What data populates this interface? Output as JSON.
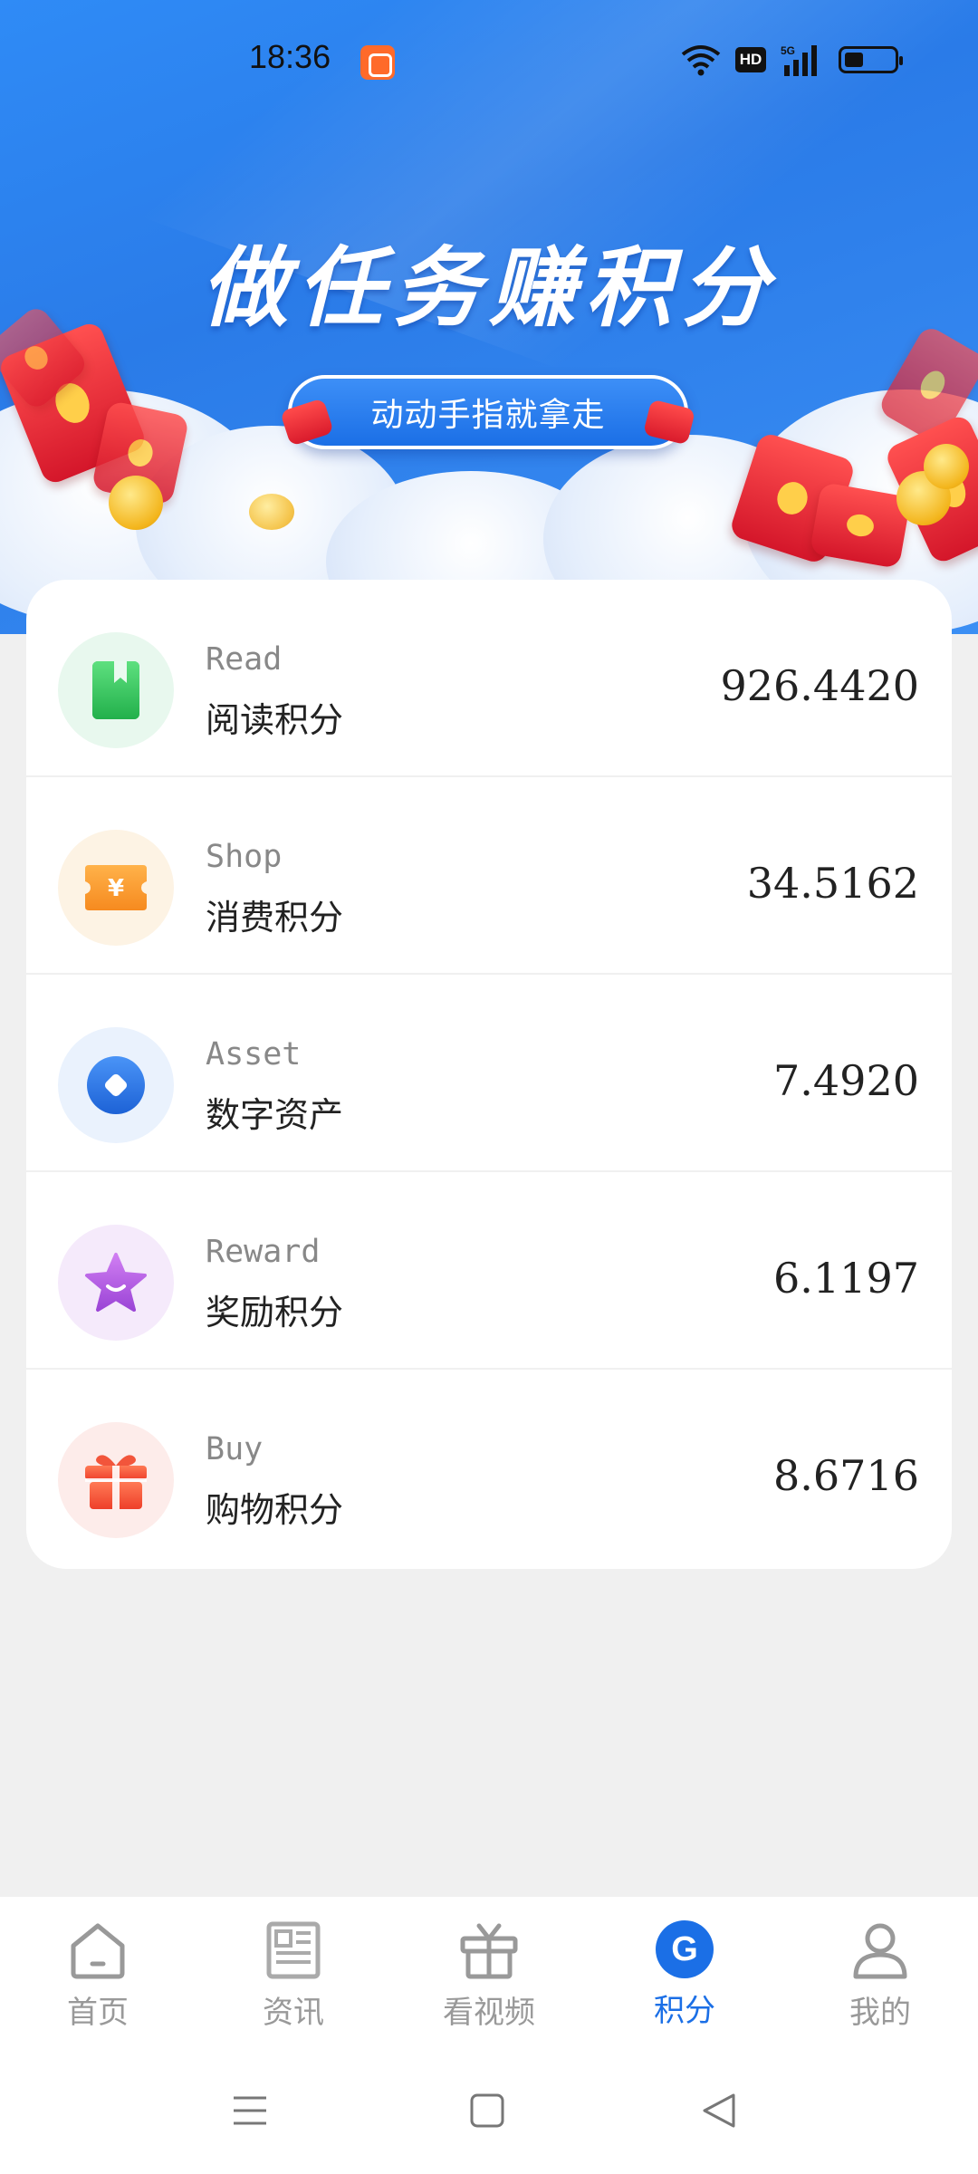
{
  "status_bar": {
    "time": "18:36",
    "hd_label": "HD"
  },
  "banner": {
    "title": "做任务赚积分",
    "pill_text": "动动手指就拿走"
  },
  "points": [
    {
      "en": "Read",
      "cn": "阅读积分",
      "value": "926.4420",
      "icon": "bookmark-icon",
      "icon_bg": "#e8f8ee",
      "icon_color": "#2fc45a"
    },
    {
      "en": "Shop",
      "cn": "消费积分",
      "value": "34.5162",
      "icon": "ticket-icon",
      "icon_bg": "#fdf3e4",
      "icon_color": "#f79a2a"
    },
    {
      "en": "Asset",
      "cn": "数字资产",
      "value": "7.4920",
      "icon": "asset-icon",
      "icon_bg": "#eaf2fd",
      "icon_color": "#2979e6"
    },
    {
      "en": "Reward",
      "cn": "奖励积分",
      "value": "6.1197",
      "icon": "star-icon",
      "icon_bg": "#f5eafb",
      "icon_color": "#b65ce0"
    },
    {
      "en": "Buy",
      "cn": "购物积分",
      "value": "8.6716",
      "icon": "gift-icon",
      "icon_bg": "#fdecea",
      "icon_color": "#f2553b"
    }
  ],
  "bottom_nav": [
    {
      "label": "首页",
      "icon": "home-icon",
      "active": false
    },
    {
      "label": "资讯",
      "icon": "news-icon",
      "active": false
    },
    {
      "label": "看视频",
      "icon": "gift-box-icon",
      "active": false
    },
    {
      "label": "积分",
      "icon": "points-g-icon",
      "active": true,
      "glyph": "G"
    },
    {
      "label": "我的",
      "icon": "profile-icon",
      "active": false
    }
  ],
  "colors": {
    "accent": "#1b6fe6",
    "banner": "#2f8bf6"
  }
}
